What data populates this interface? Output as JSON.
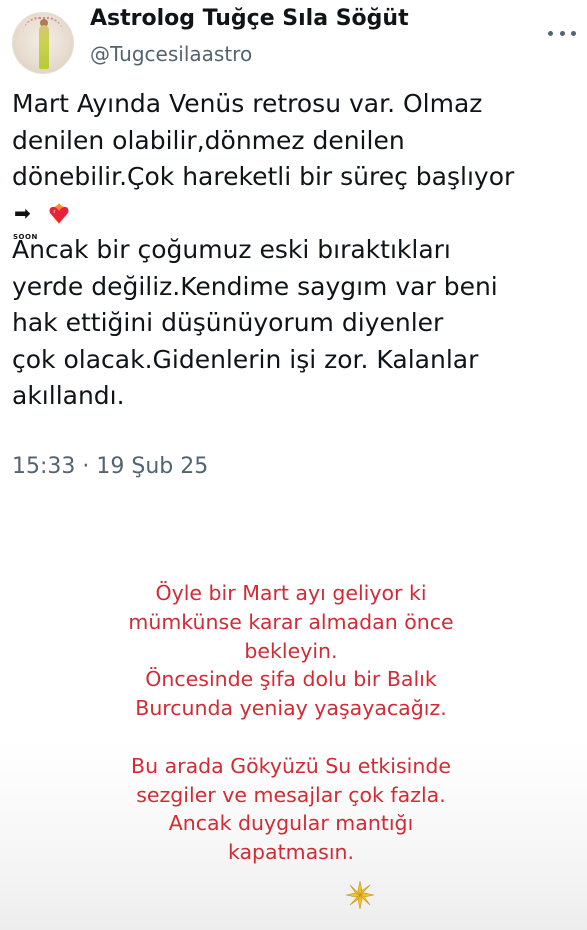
{
  "tweet": {
    "display_name": "Astrolog Tuğçe Sıla Söğüt",
    "handle": "@Tugcesilaastro",
    "lines_before_emoji": [
      "Mart Ayında Venüs retrosu var. Olmaz",
      "denilen olabilir,dönmez denilen",
      "dönebilir.Çok hareketli bir süreç başlıyor"
    ],
    "emoji": {
      "soon_label": "SOON",
      "soon_icon": "soon-arrow-icon",
      "heart_icon": "heart-on-fire-icon"
    },
    "lines_after_emoji": [
      "Ancak bir çoğumuz eski bıraktıkları",
      "yerde değiliz.Kendime saygım var beni",
      "hak ettiğini düşünüyorum diyenler",
      "çok olacak.Gidenlerin işi zor. Kalanlar",
      "akıllandı."
    ],
    "timestamp": "15:33 · 19 Şub 25"
  },
  "story": {
    "paragraph1": [
      "Öyle  bir Mart ayı geliyor ki",
      "mümkünse karar almadan önce",
      "bekleyin.",
      "Öncesinde şifa dolu bir Balık",
      "Burcunda yeniay yaşayacağız."
    ],
    "paragraph2": [
      "Bu arada Gökyüzü Su etkisinde",
      "sezgiler ve mesajlar çok fazla.",
      "Ancak duygular mantığı",
      "kapatmasın."
    ],
    "text_color": "#d12b35",
    "end_icon": "sparkle-icon"
  },
  "colors": {
    "primary_text": "#0f1419",
    "secondary_text": "#536471"
  }
}
